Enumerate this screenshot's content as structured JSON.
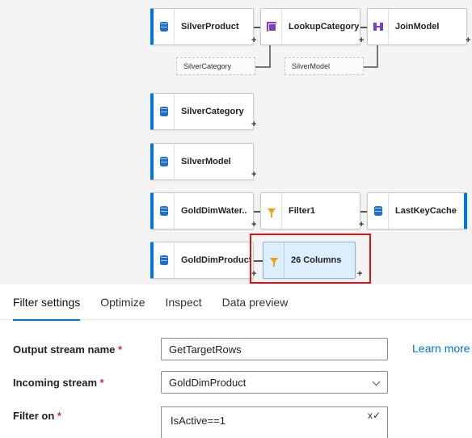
{
  "flow": {
    "nodes": {
      "silver_product": "SilverProduct",
      "lookup_category": "LookupCategory",
      "join_model": "JoinModel",
      "silver_category": "SilverCategory",
      "silver_model": "SilverModel",
      "gold_dim_water": "GoldDimWater...",
      "filter1": "Filter1",
      "last_key_cache": "LastKeyCache",
      "gold_dim_product": "GoldDimProduct",
      "columns26": "26 Columns"
    },
    "refs": {
      "silver_category": "SilverCategory",
      "silver_model": "SilverModel"
    },
    "plus": "+",
    "highlight_color": "#e0101a",
    "source_accent": "#0078d4"
  },
  "tabs": [
    {
      "label": "Filter settings",
      "active": true
    },
    {
      "label": "Optimize"
    },
    {
      "label": "Inspect"
    },
    {
      "label": "Data preview"
    }
  ],
  "form": {
    "output_stream_label": "Output stream name",
    "output_stream_value": "GetTargetRows",
    "learn_more": "Learn more",
    "incoming_stream_label": "Incoming stream",
    "incoming_stream_value": "GoldDimProduct",
    "filter_on_label": "Filter on",
    "filter_on_value": "IsActive==1",
    "required_mark": "*"
  }
}
